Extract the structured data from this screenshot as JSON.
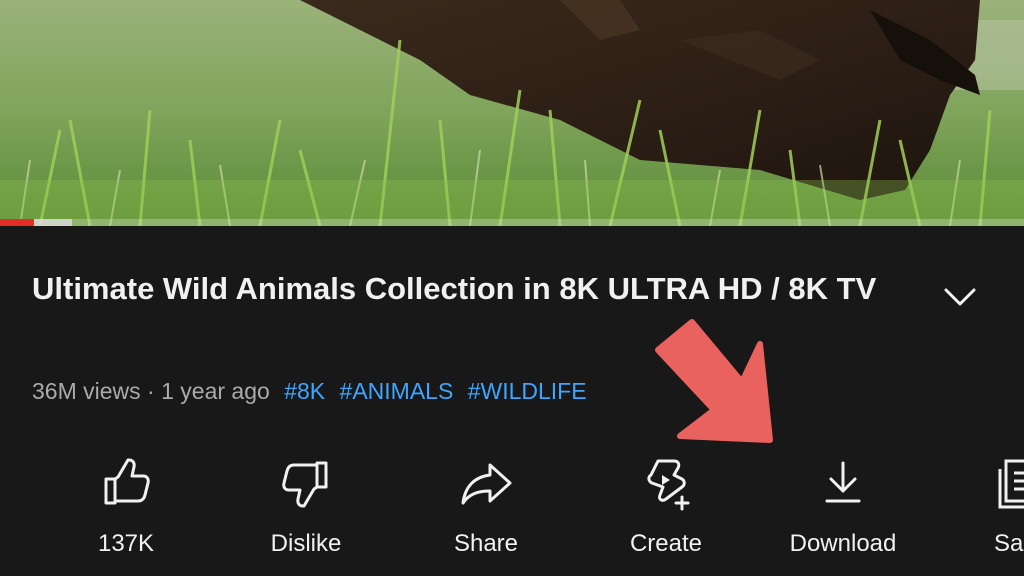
{
  "video": {
    "progress_played_fraction": 0.033,
    "progress_buffered_fraction": 0.07
  },
  "details": {
    "title": "Ultimate Wild Animals Collection in 8K ULTRA HD / 8K TV",
    "views": "36M views",
    "separator": "·",
    "age": "1 year ago",
    "hashtags": [
      "#8K",
      "#ANIMALS",
      "#WILDLIFE"
    ],
    "expand_icon": "chevron-down-icon"
  },
  "actions": [
    {
      "label": "137K",
      "icon": "thumbs-up-icon"
    },
    {
      "label": "Dislike",
      "icon": "thumbs-down-icon"
    },
    {
      "label": "Share",
      "icon": "share-arrow-icon"
    },
    {
      "label": "Create",
      "icon": "create-sparkle-icon"
    },
    {
      "label": "Download",
      "icon": "download-icon"
    },
    {
      "label": "Sa",
      "icon": "save-playlist-icon"
    }
  ],
  "annotation": {
    "icon": "pointer-arrow-icon",
    "color": "#e9625e"
  },
  "colors": {
    "background": "#181818",
    "text": "#f1f1f1",
    "muted_text": "#aaaaaa",
    "hashtag": "#3ea6ff",
    "progress": "#e52d27"
  }
}
